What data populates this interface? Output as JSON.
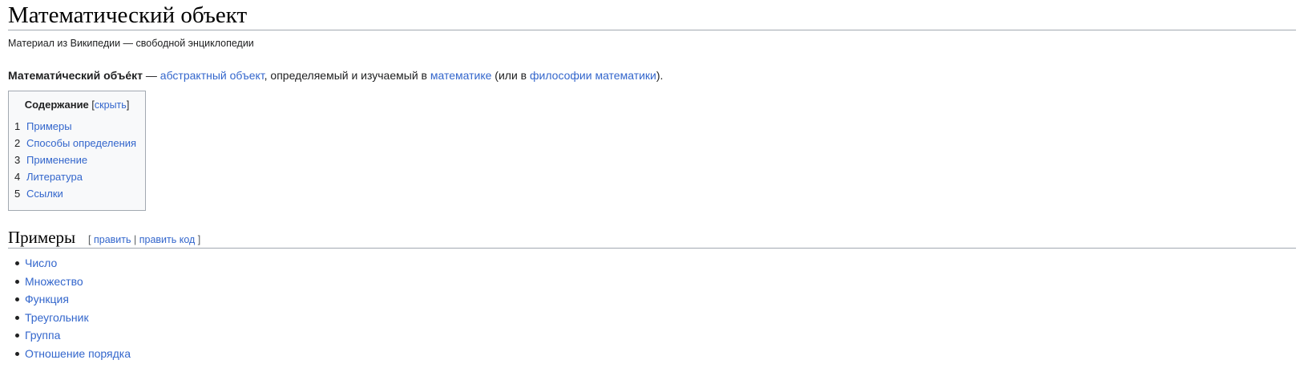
{
  "article": {
    "title": "Математический объект",
    "tagline": "Материал из Википедии — свободной энциклопедии",
    "lead": {
      "term": "Математи́ческий объе́кт",
      "dash": " — ",
      "link1": "абстрактный объект",
      "text1": ", определяемый и изучаемый в ",
      "link2": "математике",
      "text2": " (или в ",
      "link3": "философии математики",
      "text3": ")."
    }
  },
  "toc": {
    "heading": "Содержание",
    "toggle_open": "[",
    "toggle_label": "скрыть",
    "toggle_close": "]",
    "items": [
      {
        "num": "1",
        "label": "Примеры"
      },
      {
        "num": "2",
        "label": "Способы определения"
      },
      {
        "num": "3",
        "label": "Применение"
      },
      {
        "num": "4",
        "label": "Литература"
      },
      {
        "num": "5",
        "label": "Ссылки"
      }
    ]
  },
  "section": {
    "heading": "Примеры",
    "edit_open": "[ ",
    "edit_label": "править",
    "edit_sep": " | ",
    "edit_code_label": "править код",
    "edit_close": " ]",
    "items": [
      "Число",
      "Множество",
      "Функция",
      "Треугольник",
      "Группа",
      "Отношение порядка"
    ]
  },
  "colors": {
    "link": "#3366cc",
    "text": "#202122",
    "rule": "#a2a9b1",
    "toc_bg": "#f8f9fa"
  }
}
